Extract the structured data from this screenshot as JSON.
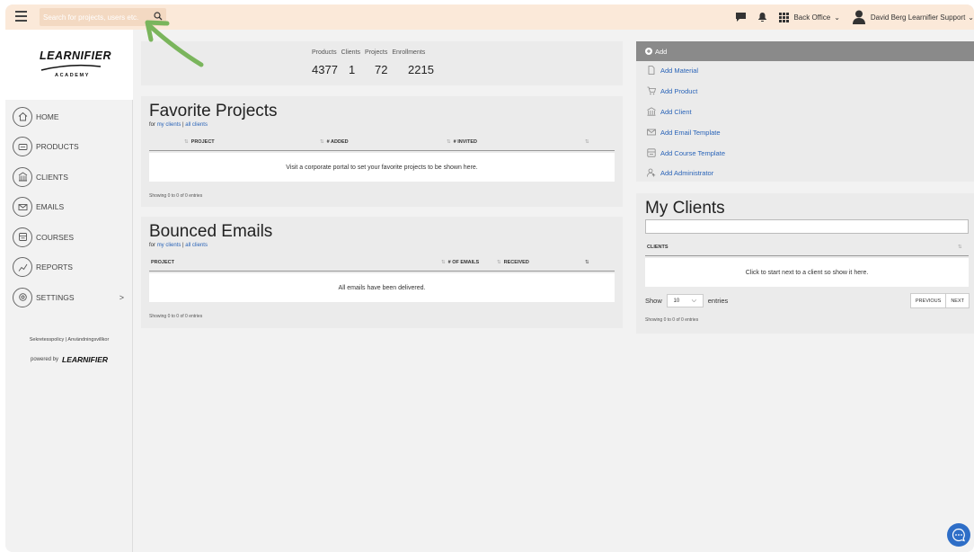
{
  "topbar": {
    "search_placeholder": "Search for projects, users etc.",
    "back_office": "Back Office",
    "user_name": "David Berg Learnifier Support"
  },
  "logo": {
    "word": "LEARNIFIER",
    "sub": "ACADEMY"
  },
  "sidebar": {
    "items": [
      {
        "label": "HOME",
        "icon": "home-icon"
      },
      {
        "label": "PRODUCTS",
        "icon": "products-icon"
      },
      {
        "label": "CLIENTS",
        "icon": "clients-icon"
      },
      {
        "label": "EMAILS",
        "icon": "emails-icon"
      },
      {
        "label": "COURSES",
        "icon": "courses-icon"
      },
      {
        "label": "REPORTS",
        "icon": "reports-icon"
      },
      {
        "label": "SETTINGS",
        "icon": "settings-icon"
      }
    ],
    "settings_chevron": ">",
    "footer_links": "Sekretesspolicy | Användningsvillkor",
    "powered_by": "powered by",
    "powered_logo": "LEARNIFIER"
  },
  "stats": {
    "labels": [
      "Products",
      "Clients",
      "Projects",
      "Enrollments"
    ],
    "values": [
      "4377",
      "1",
      "72",
      "2215"
    ]
  },
  "favorites": {
    "title": "Favorite Projects",
    "for": "for",
    "my_clients": "my clients",
    "sep": "|",
    "all_clients": "all clients",
    "columns": [
      "PROJECT",
      "# ADDED",
      "# INVITED"
    ],
    "empty": "Visit a corporate portal to set your favorite projects to be shown here.",
    "showing": "Showing 0 to 0 of 0 entries"
  },
  "bounced": {
    "title": "Bounced Emails",
    "for": "for",
    "my_clients": "my clients",
    "sep": "|",
    "all_clients": "all clients",
    "columns": [
      "PROJECT",
      "# OF EMAILS",
      "RECEIVED"
    ],
    "empty": "All emails have been delivered.",
    "showing": "Showing 0 to 0 of 0 entries"
  },
  "add": {
    "header": "Add",
    "items": [
      "Add Material",
      "Add Product",
      "Add Client",
      "Add Email Template",
      "Add Course Template",
      "Add Administrator"
    ]
  },
  "my_clients": {
    "title": "My Clients",
    "column": "CLIENTS",
    "empty": "Click to start next to a client so show it here.",
    "show": "Show",
    "page_size": "10",
    "entries": "entries",
    "previous": "PREVIOUS",
    "next": "NEXT",
    "showing": "Showing 0 to 0 of 0 entries"
  },
  "colors": {
    "topbar": "#fbe9d9",
    "link": "#2a64b8",
    "arrow": "#6aa84f"
  }
}
